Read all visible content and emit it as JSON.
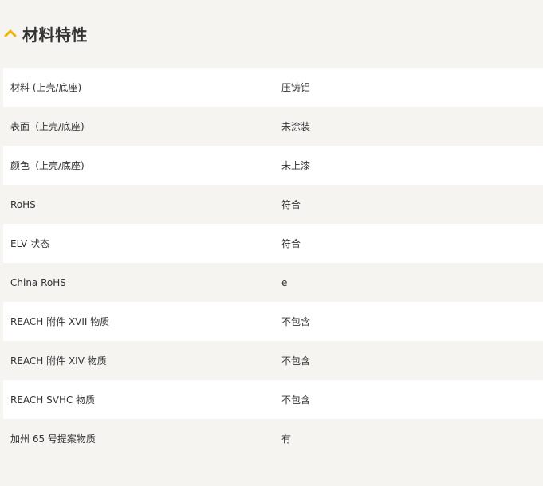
{
  "section": {
    "title": "材料特性",
    "toggle_icon": "chevron-up-icon",
    "accent_color": "#f0b400"
  },
  "rows": [
    {
      "label": "材料 (上壳/底座)",
      "value": "压铸铝"
    },
    {
      "label": "表面（上壳/底座)",
      "value": "未涂装"
    },
    {
      "label": "颜色（上壳/底座)",
      "value": "未上漆"
    },
    {
      "label": "RoHS",
      "value": "符合"
    },
    {
      "label": "ELV 状态",
      "value": "符合"
    },
    {
      "label": "China RoHS",
      "value": "e"
    },
    {
      "label": "REACH 附件 XVII 物质",
      "value": "不包含"
    },
    {
      "label": "REACH 附件 XIV 物质",
      "value": "不包含"
    },
    {
      "label": "REACH SVHC 物质",
      "value": "不包含"
    },
    {
      "label": "加州 65 号提案物质",
      "value": "有"
    }
  ]
}
